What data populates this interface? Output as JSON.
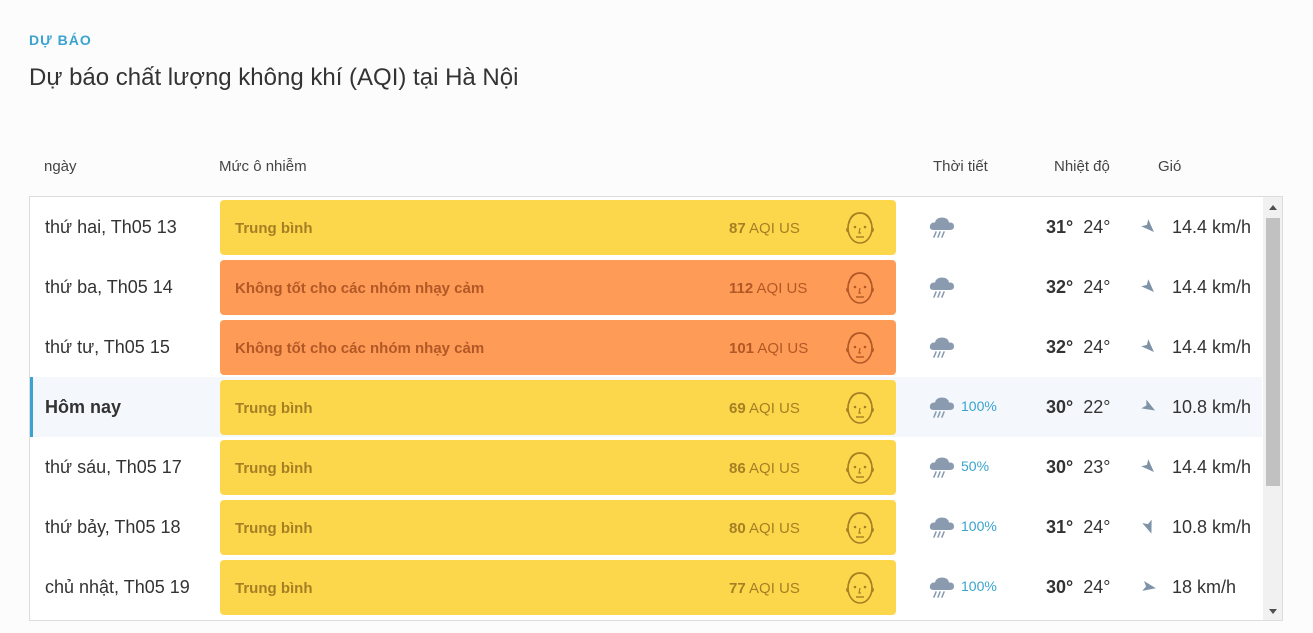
{
  "section_label": "DỰ BÁO",
  "page_title": "Dự báo chất lượng không khí (AQI) tại Hà Nội",
  "columns": {
    "day": "ngày",
    "pollution": "Mức ô nhiễm",
    "weather": "Thời tiết",
    "temperature": "Nhiệt độ",
    "wind": "Gió"
  },
  "rows": [
    {
      "date": "thứ hai, Th05 13",
      "status": "Trung bình",
      "aqi": "87",
      "unit": "AQI US",
      "level": "moderate",
      "face_icon": "moderate-face-icon",
      "weather_icon": "rain-cloud-icon",
      "rain": "",
      "temp_high": "31°",
      "temp_low": "24°",
      "wind_direction_deg": 135,
      "wind": "14.4 km/h"
    },
    {
      "date": "thứ ba, Th05 14",
      "status": "Không tốt cho các nhóm nhạy cảm",
      "aqi": "112",
      "unit": "AQI US",
      "level": "sensitive",
      "face_icon": "sensitive-face-icon",
      "weather_icon": "rain-cloud-icon",
      "rain": "",
      "temp_high": "32°",
      "temp_low": "24°",
      "wind_direction_deg": 135,
      "wind": "14.4 km/h"
    },
    {
      "date": "thứ tư, Th05 15",
      "status": "Không tốt cho các nhóm nhạy cảm",
      "aqi": "101",
      "unit": "AQI US",
      "level": "sensitive",
      "face_icon": "sensitive-face-icon",
      "weather_icon": "rain-cloud-icon",
      "rain": "",
      "temp_high": "32°",
      "temp_low": "24°",
      "wind_direction_deg": 135,
      "wind": "14.4 km/h"
    },
    {
      "date": "Hôm nay",
      "status": "Trung bình",
      "aqi": "69",
      "unit": "AQI US",
      "level": "moderate",
      "face_icon": "moderate-face-icon",
      "weather_icon": "rain-cloud-icon",
      "rain": "100%",
      "temp_high": "30°",
      "temp_low": "22°",
      "wind_direction_deg": 120,
      "wind": "10.8 km/h",
      "today": true
    },
    {
      "date": "thứ sáu, Th05 17",
      "status": "Trung bình",
      "aqi": "86",
      "unit": "AQI US",
      "level": "moderate",
      "face_icon": "moderate-face-icon",
      "weather_icon": "rain-cloud-icon",
      "rain": "50%",
      "temp_high": "30°",
      "temp_low": "23°",
      "wind_direction_deg": 135,
      "wind": "14.4 km/h"
    },
    {
      "date": "thứ bảy, Th05 18",
      "status": "Trung bình",
      "aqi": "80",
      "unit": "AQI US",
      "level": "moderate",
      "face_icon": "moderate-face-icon",
      "weather_icon": "rain-cloud-icon",
      "rain": "100%",
      "temp_high": "31°",
      "temp_low": "24°",
      "wind_direction_deg": 160,
      "wind": "10.8 km/h"
    },
    {
      "date": "chủ nhật, Th05 19",
      "status": "Trung bình",
      "aqi": "77",
      "unit": "AQI US",
      "level": "moderate",
      "face_icon": "moderate-face-icon",
      "weather_icon": "rain-cloud-icon",
      "rain": "100%",
      "temp_high": "30°",
      "temp_low": "24°",
      "wind_direction_deg": 100,
      "wind": "18 km/h"
    }
  ],
  "colors": {
    "accent": "#3aa3cf",
    "moderate_bg": "#fdd74b",
    "moderate_text": "#a57f23",
    "sensitive_bg": "#fe9b57",
    "sensitive_text": "#b25826",
    "moderate_face": "#a57f23",
    "sensitive_face": "#b25826",
    "weather_icon": "#8a9bb0",
    "wind_icon": "#7f93a8"
  },
  "scrollbar": {
    "up_icon": "scroll-up-arrow-icon",
    "down_icon": "scroll-down-arrow-icon"
  }
}
